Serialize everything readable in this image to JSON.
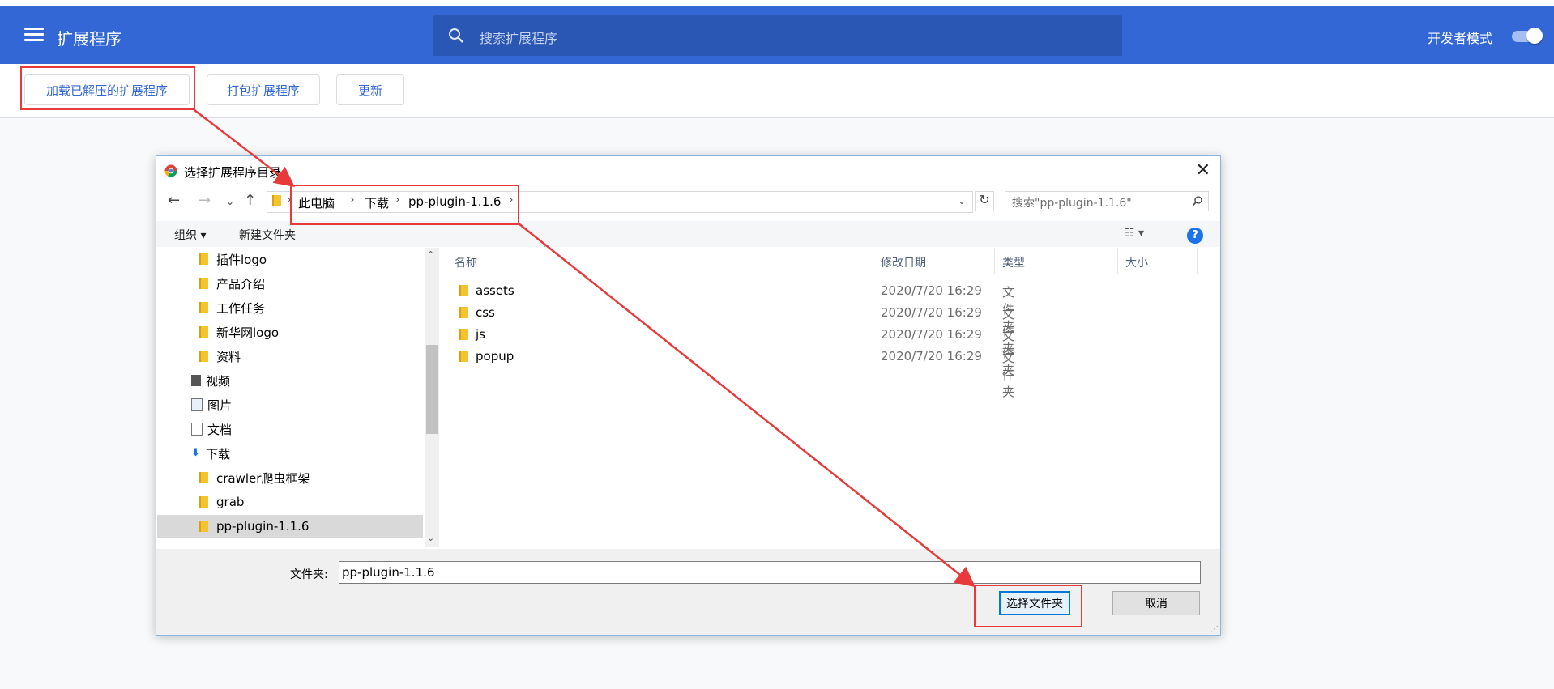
{
  "header": {
    "title": "扩展程序",
    "search_placeholder": "搜索扩展程序",
    "dev_mode_label": "开发者模式",
    "dev_mode_on": true
  },
  "actions": {
    "load_unpacked": "加载已解压的扩展程序",
    "pack": "打包扩展程序",
    "update": "更新"
  },
  "dialog": {
    "title": "选择扩展程序目录",
    "breadcrumb": [
      "此电脑",
      "下载",
      "pp-plugin-1.1.6"
    ],
    "search_placeholder": "搜索\"pp-plugin-1.1.6\"",
    "organize": "组织 ▾",
    "new_folder": "新建文件夹",
    "help": "?",
    "tree": [
      {
        "label": "插件logo",
        "kind": "folder"
      },
      {
        "label": "产品介绍",
        "kind": "folder"
      },
      {
        "label": "工作任务",
        "kind": "folder"
      },
      {
        "label": "新华网logo",
        "kind": "folder"
      },
      {
        "label": "资料",
        "kind": "folder"
      },
      {
        "label": "视频",
        "kind": "system"
      },
      {
        "label": "图片",
        "kind": "system"
      },
      {
        "label": "文档",
        "kind": "system"
      },
      {
        "label": "下载",
        "kind": "system"
      },
      {
        "label": "crawler爬虫框架",
        "kind": "folder"
      },
      {
        "label": "grab",
        "kind": "folder"
      },
      {
        "label": "pp-plugin-1.1.6",
        "kind": "folder",
        "selected": true
      }
    ],
    "columns": [
      "名称",
      "修改日期",
      "类型",
      "大小"
    ],
    "files": [
      {
        "name": "assets",
        "date": "2020/7/20 16:29",
        "type": "文件夹"
      },
      {
        "name": "css",
        "date": "2020/7/20 16:29",
        "type": "文件夹"
      },
      {
        "name": "js",
        "date": "2020/7/20 16:29",
        "type": "文件夹"
      },
      {
        "name": "popup",
        "date": "2020/7/20 16:29",
        "type": "文件夹"
      }
    ],
    "folder_label": "文件夹:",
    "folder_value": "pp-plugin-1.1.6",
    "select_button": "选择文件夹",
    "cancel_button": "取消"
  },
  "colors": {
    "header_bg": "#3367d6",
    "annotation_red": "#e8393b",
    "accent_blue": "#0078d7"
  }
}
